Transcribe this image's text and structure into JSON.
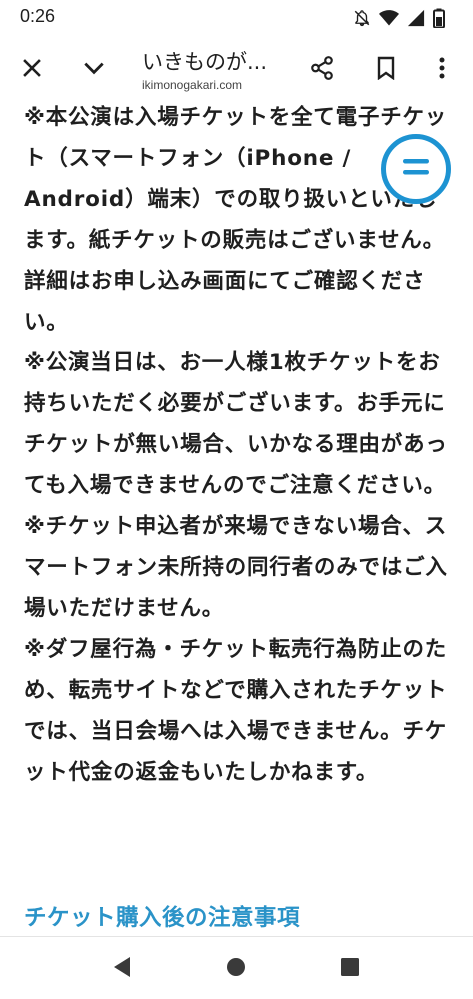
{
  "status_bar": {
    "time": "0:26",
    "icons": [
      "mute-bell-icon",
      "wifi-icon",
      "signal-icon",
      "battery-icon"
    ]
  },
  "toolbar": {
    "title": "いきものが...",
    "url": "ikimonogakari.com",
    "icons": [
      "close-icon",
      "chevron-down-icon",
      "share-icon",
      "bookmark-icon",
      "more-vert-icon"
    ]
  },
  "article": {
    "paragraphs": [
      "※本公演は入場チケットを全て電子チケット（スマートフォン（iPhone / Android）端末）での取り扱いといたします。紙チケットの販売はございません。詳細はお申し込み画面にてご確認ください。",
      "※公演当日は、お一人様1枚チケットをお持ちいただく必要がございます。お手元にチケットが無い場合、いかなる理由があっても入場できませんのでご注意ください。",
      "※チケット申込者が来場できない場合、スマートフォン未所持の同行者のみではご入場いただけません。",
      "※ダフ屋行為・チケット転売行為防止のため、転売サイトなどで購入されたチケットでは、当日会場へは入場できません。チケット代金の返金もいたしかねます。"
    ],
    "heading": "チケット購入後の注意事項"
  },
  "fab": {
    "icon": "equals-menu-icon",
    "color": "#1d93d2"
  },
  "colors": {
    "link_heading": "#2a93c8",
    "text": "#1f1f1f"
  },
  "nav_bar": {
    "icons": [
      "back-triangle-icon",
      "home-circle-icon",
      "recents-square-icon"
    ]
  }
}
